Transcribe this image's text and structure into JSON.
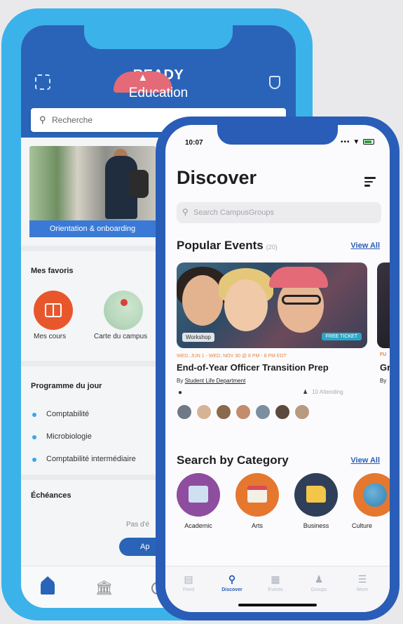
{
  "back_phone": {
    "brand_line1": "READY",
    "brand_line2": "Education",
    "search_placeholder": "Recherche",
    "banner_caption": "Orientation & onboarding",
    "favorites_title": "Mes favoris",
    "favorites": [
      {
        "label": "Mes cours",
        "icon": "book-icon"
      },
      {
        "label": "Carte du campus",
        "icon": "map-icon"
      }
    ],
    "schedule_title": "Programme du jour",
    "schedule_items": [
      "Comptabilité",
      "Microbiologie",
      "Comptabilité intermédiaire"
    ],
    "deadlines_title": "Échéances",
    "deadlines_text": "Pas d'é",
    "deadlines_button": "Ap",
    "tabs": [
      {
        "icon": "home-icon"
      },
      {
        "icon": "bank-icon"
      },
      {
        "icon": "clock-icon"
      }
    ],
    "colors": {
      "frame": "#3cb2ea",
      "header": "#2a64b8"
    }
  },
  "front_phone": {
    "status_time": "10:07",
    "title": "Discover",
    "search_placeholder": "Search CampusGroups",
    "popular_events_title": "Popular Events",
    "popular_events_count": "(20)",
    "view_all": "View All",
    "event": {
      "tag": "Workshop",
      "price": "FREE TICKET",
      "date": "WED, JUN 1 - WED, NOV 30 @ 6 PM - 8 PM EDT",
      "title": "End-of-Year Officer Transition Prep",
      "by_prefix": "By",
      "organizer": "Student Life Department",
      "attending": "10 Attending"
    },
    "partial_event": {
      "title": "Gr",
      "by": "By",
      "date": "FU"
    },
    "category_title": "Search by Category",
    "category_view_all": "View All",
    "categories": [
      {
        "label": "Academic",
        "icon": "academic-building-icon"
      },
      {
        "label": "Arts",
        "icon": "arts-easel-icon"
      },
      {
        "label": "Business",
        "icon": "business-folder-icon"
      },
      {
        "label": "Culture",
        "icon": "globe-icon"
      }
    ],
    "tabs": [
      {
        "label": "Feed",
        "icon": "feed-icon"
      },
      {
        "label": "Discover",
        "icon": "search-icon",
        "active": true
      },
      {
        "label": "Events",
        "icon": "calendar-icon"
      },
      {
        "label": "Groups",
        "icon": "groups-icon"
      },
      {
        "label": "More",
        "icon": "menu-icon"
      }
    ],
    "colors": {
      "frame": "#2a5db7",
      "accent": "#2a5db7",
      "date": "#e7863a"
    }
  }
}
